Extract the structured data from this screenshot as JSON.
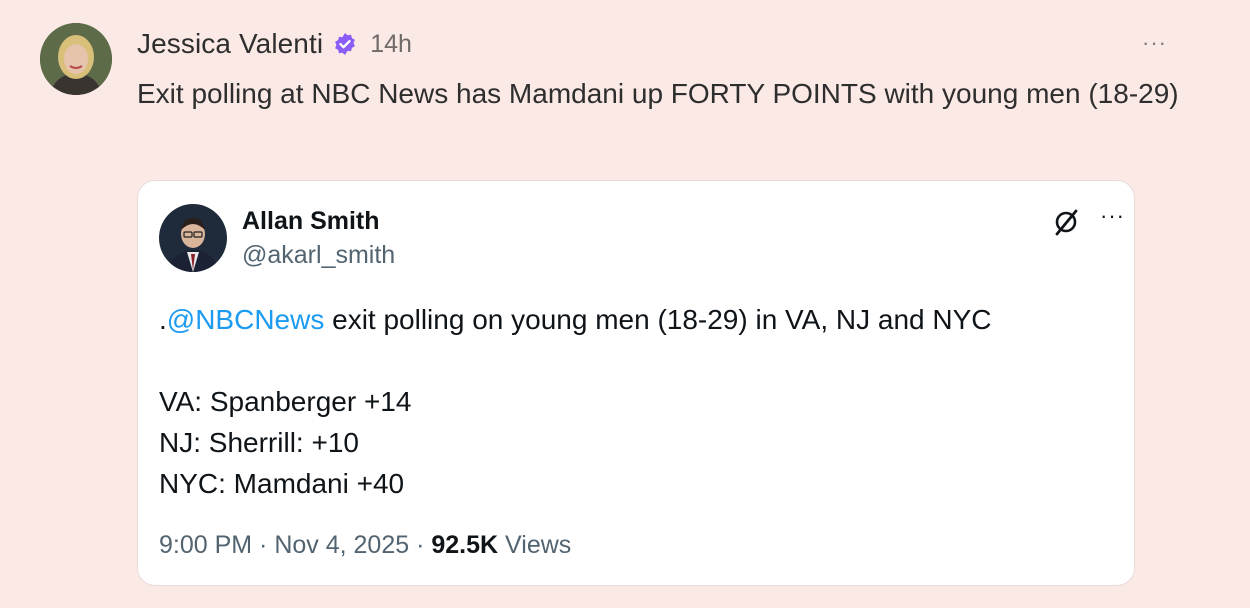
{
  "post": {
    "author": "Jessica Valenti",
    "time_ago": "14h",
    "text": "Exit polling at NBC News has Mamdani up FORTY POINTS with young men (18-29)",
    "more_label": "···",
    "verified_color": "#8b5cf6"
  },
  "quoted": {
    "name": "Allan Smith",
    "handle": "@akarl_smith",
    "mention_prefix": ".",
    "mention": "@NBCNews",
    "text_rest": " exit polling on young men (18-29) in VA, NJ and NYC",
    "lines": [
      "VA: Spanberger +14",
      "NJ: Sherrill: +10",
      "NYC: Mamdani +40"
    ],
    "time": "9:00 PM",
    "separator": " · ",
    "date": "Nov 4, 2025",
    "views_count": "92.5K",
    "views_label": " Views",
    "more_label": "···",
    "link_color": "#1d9bf0"
  }
}
